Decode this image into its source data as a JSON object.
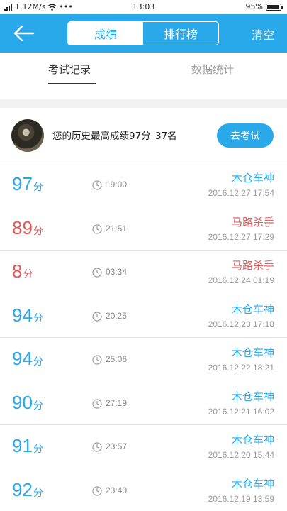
{
  "status_bar": {
    "signal": "1.12M/s",
    "time": "13:03",
    "battery": "95%"
  },
  "header": {
    "tabs": [
      {
        "label": "成绩",
        "active": true
      },
      {
        "label": "排行榜",
        "active": false
      }
    ],
    "clear_label": "清空",
    "back_icon": "back-arrow-icon"
  },
  "subtabs": {
    "records_label": "考试记录",
    "stats_label": "数据统计"
  },
  "best": {
    "text": "您的历史最高成绩97分",
    "rank": "37名",
    "button_label": "去考试"
  },
  "colors": {
    "accent": "#29a8ea",
    "fail": "#e05a5a"
  },
  "records": [
    {
      "score": "97",
      "unit": "分",
      "duration": "19:00",
      "title": "木仓车神",
      "date": "2016.12.27   17:54",
      "pass": true
    },
    {
      "score": "89",
      "unit": "分",
      "duration": "21:51",
      "title": "马路杀手",
      "date": "2016.12.27   17:29",
      "pass": false
    },
    {
      "score": "8",
      "unit": "分",
      "duration": "03:34",
      "title": "马路杀手",
      "date": "2016.12.24   01:19",
      "pass": false
    },
    {
      "score": "94",
      "unit": "分",
      "duration": "20:25",
      "title": "木仓车神",
      "date": "2016.12.23   17:18",
      "pass": true
    },
    {
      "score": "94",
      "unit": "分",
      "duration": "25:06",
      "title": "木仓车神",
      "date": "2016.12.22   18:21",
      "pass": true
    },
    {
      "score": "90",
      "unit": "分",
      "duration": "27:19",
      "title": "木仓车神",
      "date": "2016.12.21   16:02",
      "pass": true
    },
    {
      "score": "91",
      "unit": "分",
      "duration": "23:57",
      "title": "木仓车神",
      "date": "2016.12.20   15:44",
      "pass": true
    },
    {
      "score": "92",
      "unit": "分",
      "duration": "23:40",
      "title": "木仓车神",
      "date": "2016.12.19   13:59",
      "pass": true
    }
  ]
}
